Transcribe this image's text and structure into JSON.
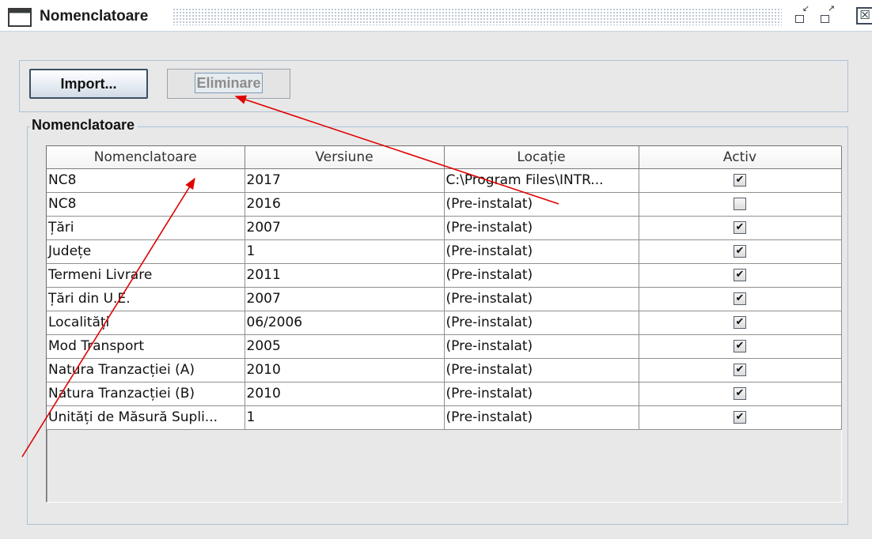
{
  "window": {
    "title": "Nomenclatoare",
    "controls": {
      "minimize_icon": "minimize-icon",
      "maximize_icon": "maximize-icon",
      "close_icon": "close-icon",
      "close_glyph": "☒"
    }
  },
  "toolbar": {
    "import_label": "Import...",
    "remove_label": "Eliminare"
  },
  "group": {
    "label": "Nomenclatoare"
  },
  "table": {
    "columns": [
      "Nomenclatoare",
      "Versiune",
      "Locație",
      "Activ"
    ],
    "rows": [
      {
        "name": "NC8",
        "version": "2017",
        "location": "C:\\Program Files\\INTR...",
        "active": true
      },
      {
        "name": "NC8",
        "version": "2016",
        "location": "(Pre-instalat)",
        "active": false
      },
      {
        "name": "Țări",
        "version": "2007",
        "location": "(Pre-instalat)",
        "active": true
      },
      {
        "name": "Județe",
        "version": "1",
        "location": "(Pre-instalat)",
        "active": true
      },
      {
        "name": "Termeni Livrare",
        "version": "2011",
        "location": "(Pre-instalat)",
        "active": true
      },
      {
        "name": "Țări din U.E.",
        "version": "2007",
        "location": "(Pre-instalat)",
        "active": true
      },
      {
        "name": "Localități",
        "version": "06/2006",
        "location": "(Pre-instalat)",
        "active": true
      },
      {
        "name": "Mod Transport",
        "version": "2005",
        "location": "(Pre-instalat)",
        "active": true
      },
      {
        "name": "Natura Tranzacției (A)",
        "version": "2010",
        "location": "(Pre-instalat)",
        "active": true
      },
      {
        "name": "Natura Tranzacției (B)",
        "version": "2010",
        "location": "(Pre-instalat)",
        "active": true
      },
      {
        "name": "Unități de Măsură Supli...",
        "version": "1",
        "location": "(Pre-instalat)",
        "active": true
      }
    ]
  },
  "colors": {
    "background": "#e8e8e8",
    "panel_border": "#a9c2da",
    "annotation_arrow": "#e00000",
    "disabled_text": "#8c8c8c"
  }
}
